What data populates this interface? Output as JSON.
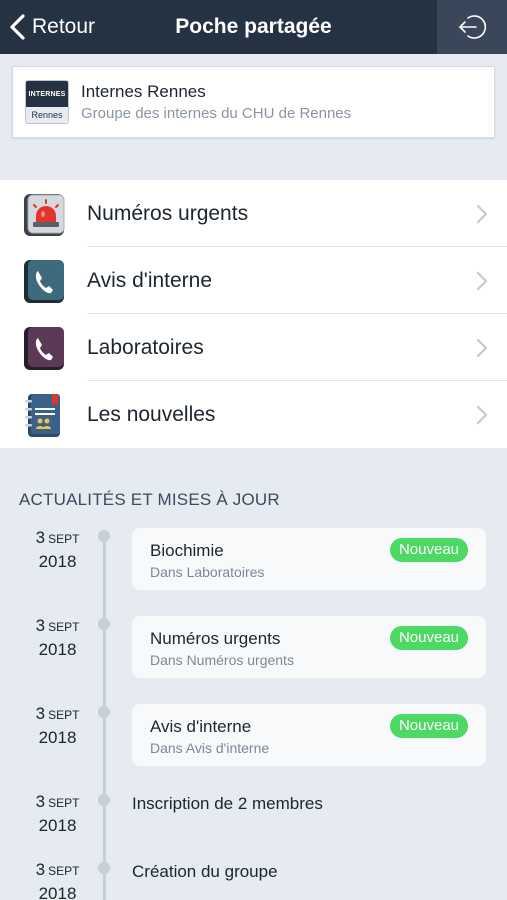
{
  "nav": {
    "back_label": "Retour",
    "title": "Poche partagée",
    "action_icon": "leave-icon"
  },
  "group": {
    "logo_top": "INTERNES",
    "logo_bottom": "Rennes",
    "name": "Internes Rennes",
    "description": "Groupe des internes du CHU de Rennes"
  },
  "menu": {
    "items": [
      {
        "label": "Numéros urgents",
        "icon": "emergency-phone-icon"
      },
      {
        "label": "Avis d'interne",
        "icon": "phone-book-blue-icon"
      },
      {
        "label": "Laboratoires",
        "icon": "phone-book-purple-icon"
      },
      {
        "label": "Les nouvelles",
        "icon": "news-notebook-icon"
      }
    ]
  },
  "timeline": {
    "section_title": "ACTUALITÉS ET MISES À JOUR",
    "entries": [
      {
        "day": "3",
        "month": "SEPT",
        "year": "2018",
        "title": "Biochimie",
        "subtitle": "Dans Laboratoires",
        "badge": "Nouveau"
      },
      {
        "day": "3",
        "month": "SEPT",
        "year": "2018",
        "title": "Numéros urgents",
        "subtitle": "Dans Numéros urgents",
        "badge": "Nouveau"
      },
      {
        "day": "3",
        "month": "SEPT",
        "year": "2018",
        "title": "Avis d'interne",
        "subtitle": "Dans Avis d'interne",
        "badge": "Nouveau"
      },
      {
        "day": "3",
        "month": "SEPT",
        "year": "2018",
        "text": "Inscription de 2 membres"
      },
      {
        "day": "3",
        "month": "SEPT",
        "year": "2018",
        "text": "Création du groupe"
      }
    ]
  },
  "colors": {
    "navbar": "#243244",
    "badge_green": "#4cd964",
    "background": "#e6ebf2"
  }
}
